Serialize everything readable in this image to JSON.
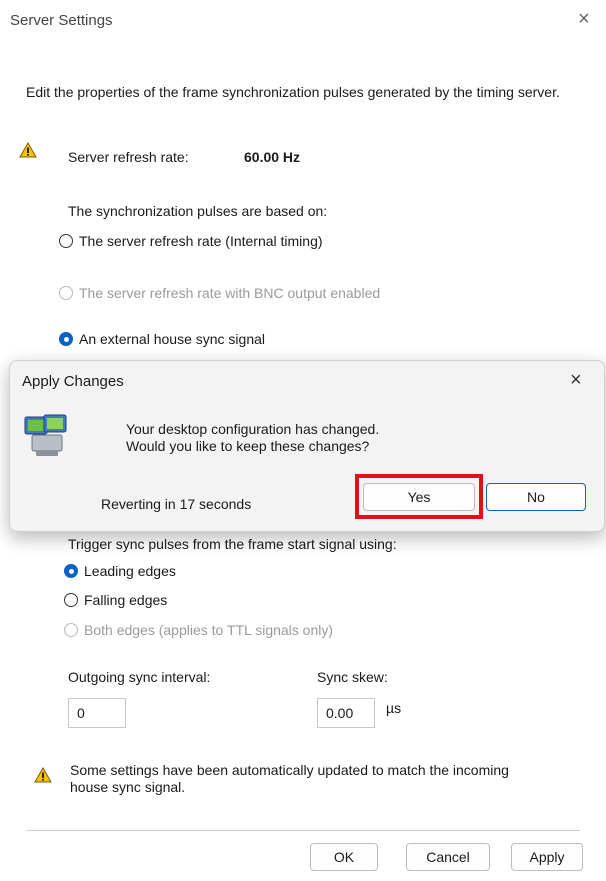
{
  "window": {
    "title": "Server Settings",
    "close_glyph": "×"
  },
  "description": "Edit the properties of the frame synchronization pulses generated by the timing server.",
  "refresh": {
    "label": "Server refresh rate:",
    "value": "60.00 Hz",
    "icon": "warning-icon"
  },
  "sync_source": {
    "heading": "The synchronization pulses are based on:",
    "options": [
      {
        "label": "The server refresh rate (Internal timing)",
        "checked": false,
        "enabled": true
      },
      {
        "label": "The server refresh rate with BNC output enabled",
        "checked": false,
        "enabled": false
      },
      {
        "label": "An external house sync signal",
        "checked": true,
        "enabled": true
      }
    ]
  },
  "trigger": {
    "heading": "Trigger sync pulses from the frame start signal using:",
    "options": [
      {
        "label": "Leading edges",
        "checked": true,
        "enabled": true
      },
      {
        "label": "Falling edges",
        "checked": false,
        "enabled": true
      },
      {
        "label": "Both edges (applies to TTL signals only)",
        "checked": false,
        "enabled": false
      }
    ]
  },
  "interval": {
    "label": "Outgoing sync interval:",
    "value": "0"
  },
  "skew": {
    "label": "Sync skew:",
    "value": "0.00",
    "unit": "µs"
  },
  "note": "Some settings have been automatically updated to match the incoming house sync signal.",
  "buttons": {
    "ok": "OK",
    "cancel": "Cancel",
    "apply": "Apply"
  },
  "dialog": {
    "title": "Apply Changes",
    "close_glyph": "×",
    "message_line1": "Your desktop configuration has changed.",
    "message_line2": "Would you like to keep these changes?",
    "countdown": "Reverting in 17 seconds",
    "yes": "Yes",
    "no": "No",
    "icon": "display-settings-icon"
  },
  "colors": {
    "accent": "#0b62c4",
    "highlight": "#e0101a",
    "warning": "#f5c400"
  }
}
